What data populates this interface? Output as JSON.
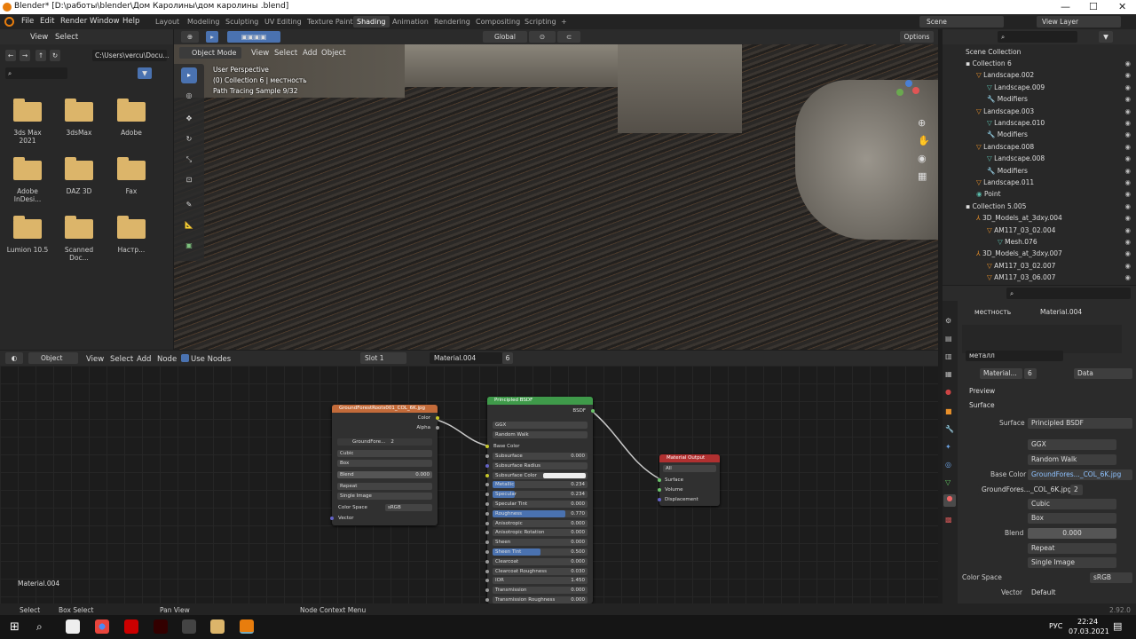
{
  "window": {
    "title": "Blender* [D:\\работы\\blender\\Дом Каролины\\дом каролины .blend]",
    "min": "—",
    "max": "☐",
    "close": "✕"
  },
  "menus": [
    "File",
    "Edit",
    "Render",
    "Window",
    "Help"
  ],
  "workspaces": [
    "Layout",
    "Modeling",
    "Sculpting",
    "UV Editing",
    "Texture Paint",
    "Shading",
    "Animation",
    "Rendering",
    "Compositing",
    "Scripting"
  ],
  "active_workspace": "Shading",
  "scene": {
    "scene": "Scene",
    "view_layer": "View Layer"
  },
  "filebrowser": {
    "view": "View",
    "select": "Select",
    "path": "C:\\Users\\vercu\\Docu...",
    "folders": [
      "3ds Max 2021",
      "3dsMax",
      "Adobe",
      "Adobe InDesi...",
      "DAZ 3D",
      "Fax",
      "Lumion 10.5",
      "Scanned Doc...",
      "Настр..."
    ]
  },
  "viewport": {
    "mode": "Object Mode",
    "view": "View",
    "select": "Select",
    "add": "Add",
    "object": "Object",
    "transform": "Global",
    "options": "Options",
    "overlay_line1": "User Perspective",
    "overlay_line2": "(0) Collection 6 | местность",
    "overlay_line3": "Path Tracing Sample 9/32"
  },
  "node_editor": {
    "type": "Object",
    "view": "View",
    "select": "Select",
    "add": "Add",
    "node": "Node",
    "use_nodes": "Use Nodes",
    "slot": "Slot 1",
    "material": "Material.004",
    "users": "6",
    "footer": "Material.004"
  },
  "image_node": {
    "title": "GroundForestRoots001_COL_6K.jpg",
    "out_color": "Color",
    "out_alpha": "Alpha",
    "image": "GroundFore...",
    "users": "2",
    "interp": "Cubic",
    "proj": "Box",
    "blend_label": "Blend",
    "blend_value": "0.000",
    "ext": "Repeat",
    "source": "Single Image",
    "cs_label": "Color Space",
    "cs_value": "sRGB",
    "vector": "Vector"
  },
  "bsdf_node": {
    "title": "Principled BSDF",
    "out": "BSDF",
    "dist": "GGX",
    "sss": "Random Walk",
    "base_color": "Base Color",
    "rows": [
      [
        "Subsurface",
        "0.000"
      ],
      [
        "Subsurface Radius",
        ""
      ],
      [
        "Subsurface Color",
        ""
      ],
      [
        "Metallic",
        "0.234"
      ],
      [
        "Specular",
        "0.234"
      ],
      [
        "Specular Tint",
        "0.000"
      ],
      [
        "Roughness",
        "0.770"
      ],
      [
        "Anisotropic",
        "0.000"
      ],
      [
        "Anisotropic Rotation",
        "0.000"
      ],
      [
        "Sheen",
        "0.000"
      ],
      [
        "Sheen Tint",
        "0.500"
      ],
      [
        "Clearcoat",
        "0.000"
      ],
      [
        "Clearcoat Roughness",
        "0.030"
      ],
      [
        "IOR",
        "1.450"
      ],
      [
        "Transmission",
        "0.000"
      ],
      [
        "Transmission Roughness",
        "0.000"
      ]
    ]
  },
  "output_node": {
    "title": "Material Output",
    "target": "All",
    "inputs": [
      "Surface",
      "Volume",
      "Displacement"
    ]
  },
  "outliner": {
    "root": "Scene Collection",
    "items": [
      {
        "name": "Collection 6",
        "lvl": 1,
        "icon": "coll"
      },
      {
        "name": "Landscape.002",
        "lvl": 2,
        "icon": "obj"
      },
      {
        "name": "Landscape.009",
        "lvl": 3,
        "icon": "mesh"
      },
      {
        "name": "Modifiers",
        "lvl": 3,
        "icon": "mod"
      },
      {
        "name": "Landscape.003",
        "lvl": 2,
        "icon": "obj"
      },
      {
        "name": "Landscape.010",
        "lvl": 3,
        "icon": "mesh"
      },
      {
        "name": "Modifiers",
        "lvl": 3,
        "icon": "mod"
      },
      {
        "name": "Landscape.008",
        "lvl": 2,
        "icon": "obj"
      },
      {
        "name": "Landscape.008",
        "lvl": 3,
        "icon": "mesh"
      },
      {
        "name": "Modifiers",
        "lvl": 3,
        "icon": "mod"
      },
      {
        "name": "Landscape.011",
        "lvl": 2,
        "icon": "obj"
      },
      {
        "name": "Point",
        "lvl": 2,
        "icon": "light"
      },
      {
        "name": "Collection 5.005",
        "lvl": 1,
        "icon": "coll"
      },
      {
        "name": "3D_Models_at_3dxy.004",
        "lvl": 2,
        "icon": "empty"
      },
      {
        "name": "AM117_03_02.004",
        "lvl": 3,
        "icon": "obj"
      },
      {
        "name": "Mesh.076",
        "lvl": 4,
        "icon": "mesh"
      },
      {
        "name": "3D_Models_at_3dxy.007",
        "lvl": 2,
        "icon": "empty"
      },
      {
        "name": "AM117_03_02.007",
        "lvl": 3,
        "icon": "obj"
      },
      {
        "name": "AM117_03_06.007",
        "lvl": 3,
        "icon": "obj"
      }
    ]
  },
  "properties": {
    "object": "местность",
    "material": "Material.004",
    "slot_name": "металл",
    "mat_field": "Material...",
    "mat_users": "6",
    "link": "Data",
    "preview": "Preview",
    "surface_panel": "Surface",
    "surface_label": "Surface",
    "surface_value": "Principled BSDF",
    "ggx": "GGX",
    "random_walk": "Random Walk",
    "base_color_label": "Base Color",
    "base_color_value": "GroundFores..._COL_6K.jpg",
    "image": "GroundFores..._COL_6K.jpg",
    "image_users": "2",
    "cubic": "Cubic",
    "box": "Box",
    "blend_label": "Blend",
    "blend_value": "0.000",
    "repeat": "Repeat",
    "single_image": "Single Image",
    "cs_label": "Color Space",
    "cs_value": "sRGB",
    "vector_label": "Vector",
    "vector_value": "Default"
  },
  "status": {
    "select": "Select",
    "box_select": "Box Select",
    "pan": "Pan View",
    "ctx": "Node Context Menu",
    "version": "2.92.0"
  },
  "taskbar": {
    "lang": "РУС",
    "time": "22:24",
    "date": "07.03.2021"
  }
}
